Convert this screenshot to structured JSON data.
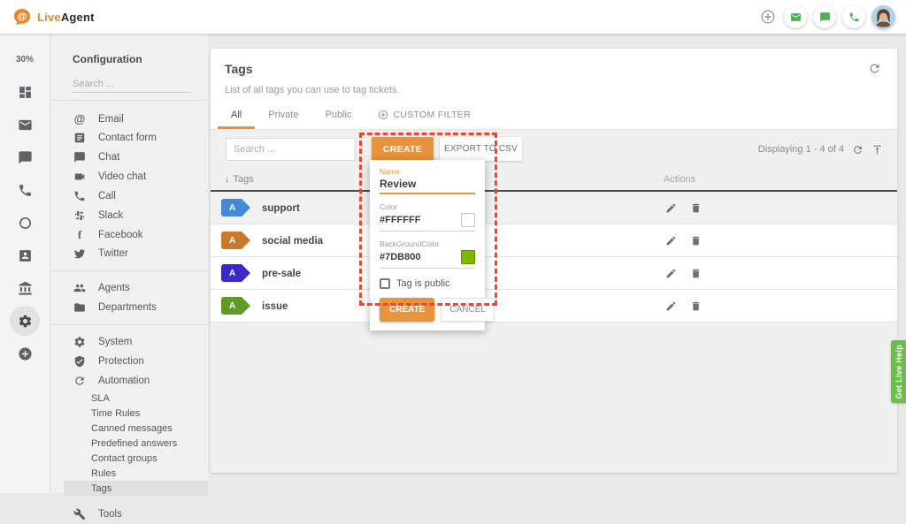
{
  "topbar": {
    "logo_live": "Live",
    "logo_agent": "Agent"
  },
  "rail": {
    "usage_percent": "30%"
  },
  "config": {
    "title": "Configuration",
    "search_placeholder": "Search ...",
    "channels": [
      "Email",
      "Contact form",
      "Chat",
      "Video chat",
      "Call",
      "Slack",
      "Facebook",
      "Twitter"
    ],
    "org": [
      "Agents",
      "Departments"
    ],
    "system_group": [
      "System",
      "Protection",
      "Automation"
    ],
    "automation_sub": [
      "SLA",
      "Time Rules",
      "Canned messages",
      "Predefined answers",
      "Contact groups",
      "Rules",
      "Tags"
    ],
    "tools": "Tools"
  },
  "main": {
    "title": "Tags",
    "subtitle": "List of all tags you can use to tag tickets.",
    "tabs": [
      "All",
      "Private",
      "Public",
      "CUSTOM FILTER"
    ],
    "toolbar": {
      "search_placeholder": "Search ...",
      "create": "CREATE",
      "export": "EXPORT TO CSV",
      "displaying": "Displaying 1 - 4 of 4"
    },
    "table": {
      "col_tags": "Tags",
      "col_arrow": "↓",
      "col_actions": "Actions",
      "badge_letter": "A",
      "rows": [
        {
          "name": "support",
          "color": "#4488d8"
        },
        {
          "name": "social media",
          "color": "#c8792a"
        },
        {
          "name": "pre-sale",
          "color": "#3a28c8"
        },
        {
          "name": "issue",
          "color": "#609b28"
        }
      ]
    }
  },
  "dialog": {
    "name_label": "Name",
    "name_value": "Review",
    "color_label": "Color",
    "color_value": "#FFFFFF",
    "background_label": "BackGroundColor",
    "background_value": "#7DB800",
    "public_label": "Tag is public",
    "create": "CREATE",
    "cancel": "CANCEL"
  },
  "help_tab": {
    "label": "Get Live Help"
  },
  "colors": {
    "accent_orange": "#E8943C",
    "highlight_red": "#EF4631",
    "help_green": "#6ABF49"
  }
}
